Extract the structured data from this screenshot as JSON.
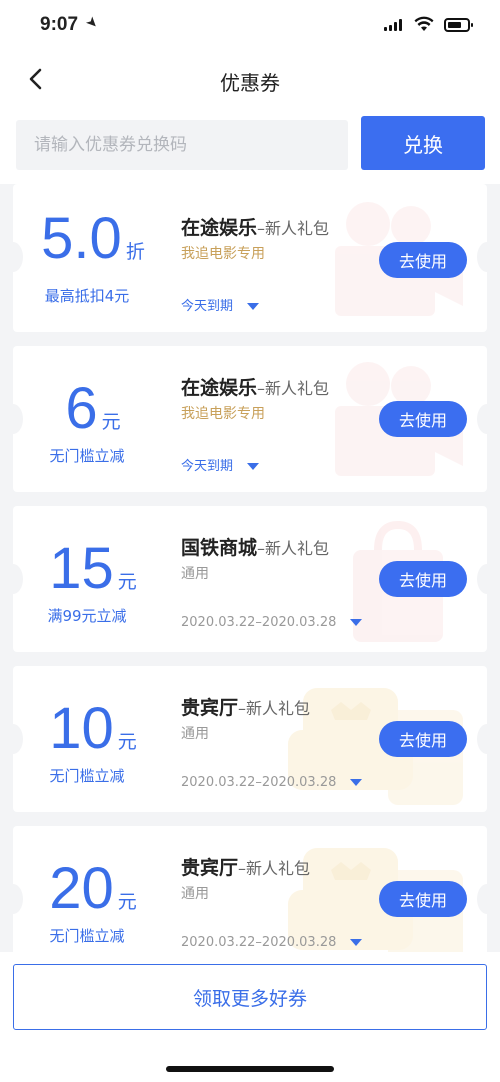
{
  "status_bar": {
    "time": "9:07"
  },
  "nav": {
    "title": "优惠券"
  },
  "redeem": {
    "placeholder": "请输入优惠券兑换码",
    "button_label": "兑换"
  },
  "coupons": [
    {
      "value": "5.0",
      "unit": "折",
      "condition": "最高抵扣4元",
      "name": "在途娱乐",
      "tag": "–新人礼包",
      "scope": "我追电影专用",
      "expiry": "今天到期",
      "button_label": "去使用",
      "watermark": "camera-icon"
    },
    {
      "value": "6",
      "unit": "元",
      "condition": "无门槛立减",
      "name": "在途娱乐",
      "tag": "–新人礼包",
      "scope": "我追电影专用",
      "expiry": "今天到期",
      "button_label": "去使用",
      "watermark": "camera-icon"
    },
    {
      "value": "15",
      "unit": "元",
      "condition": "满99元立减",
      "name": "国铁商城",
      "tag": "–新人礼包",
      "scope": "通用",
      "expiry": "2020.03.22–2020.03.28",
      "button_label": "去使用",
      "watermark": "shopping-bag-icon"
    },
    {
      "value": "10",
      "unit": "元",
      "condition": "无门槛立减",
      "name": "贵宾厅",
      "tag": "–新人礼包",
      "scope": "通用",
      "expiry": "2020.03.22–2020.03.28",
      "button_label": "去使用",
      "watermark": "armchair-icon"
    },
    {
      "value": "20",
      "unit": "元",
      "condition": "无门槛立减",
      "name": "贵宾厅",
      "tag": "–新人礼包",
      "scope": "通用",
      "expiry": "2020.03.22–2020.03.28",
      "button_label": "去使用",
      "watermark": "armchair-icon"
    }
  ],
  "footer": {
    "button_label": "领取更多好券"
  },
  "colors": {
    "accent": "#3b6ef0",
    "gold": "#c8a05a",
    "background": "#f3f4f6"
  }
}
